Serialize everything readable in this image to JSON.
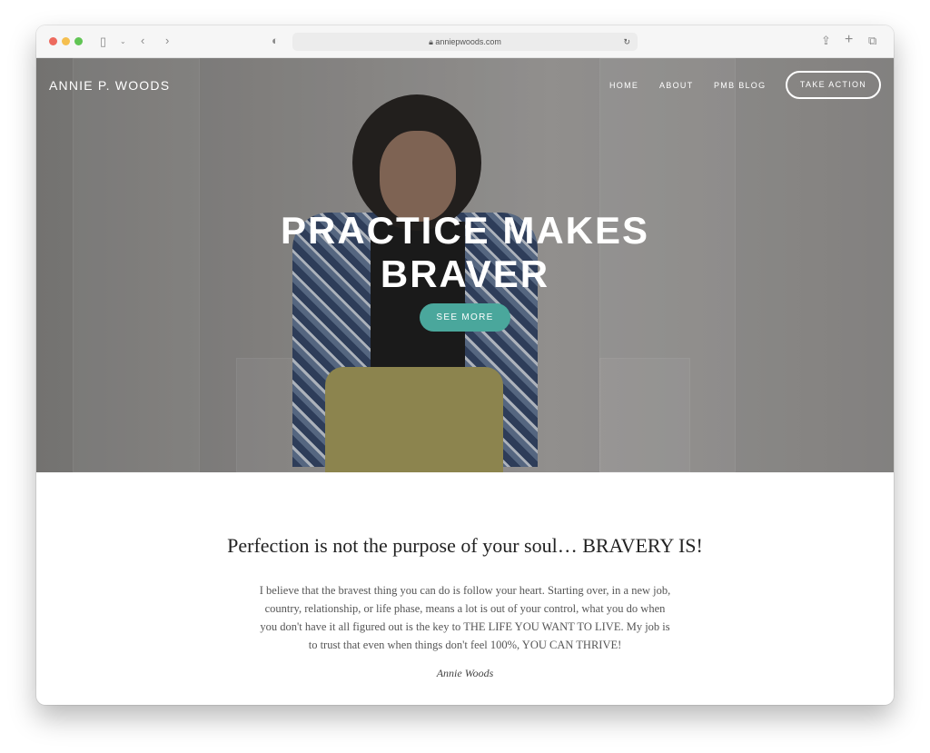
{
  "browser": {
    "url": "anniepwoods.com",
    "traffic_colors": [
      "#ed6a5e",
      "#f5bf4f",
      "#61c554"
    ]
  },
  "site": {
    "logo": "ANNIE P. WOODS",
    "nav": [
      "HOME",
      "ABOUT",
      "PMB BLOG"
    ],
    "cta": "TAKE ACTION"
  },
  "hero": {
    "title_line1": "PRACTICE MAKES",
    "title_line2": "BRAVER",
    "button": "SEE MORE",
    "button_color": "#4aa79c"
  },
  "content": {
    "quote": "Perfection is not the purpose of your soul… BRAVERY IS!",
    "body": "I believe that the bravest thing you can do is follow your heart. Starting over, in a new job, country, relationship, or life phase, means a lot is out of your control, what you do when you don't have it all figured out is the key to THE LIFE YOU WANT TO LIVE. My job is to trust that even when things don't feel 100%, YOU CAN THRIVE!",
    "signature": "Annie Woods"
  }
}
